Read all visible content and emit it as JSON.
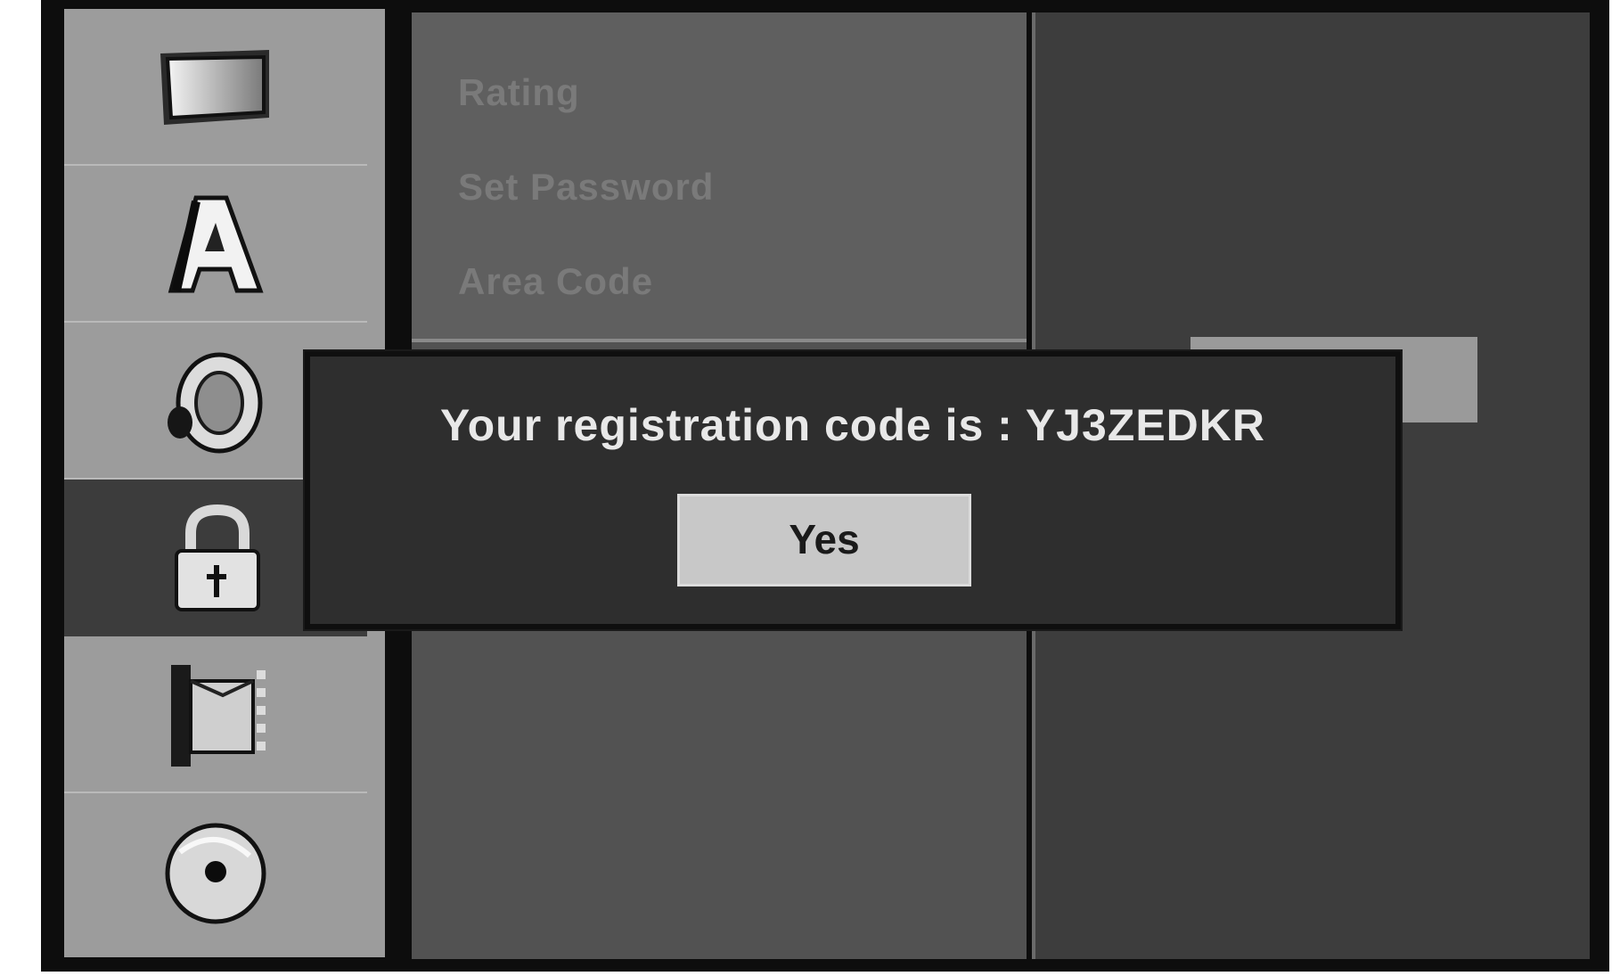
{
  "sidebar": {
    "items": [
      {
        "icon": "tv-screen-icon",
        "active": false
      },
      {
        "icon": "language-a-icon",
        "active": false
      },
      {
        "icon": "speaker-icon",
        "active": false
      },
      {
        "icon": "lock-icon",
        "active": true
      },
      {
        "icon": "film-strip-icon",
        "active": false
      },
      {
        "icon": "disc-icon",
        "active": false
      }
    ]
  },
  "submenu": {
    "items": [
      {
        "label": "Rating"
      },
      {
        "label": "Set Password"
      },
      {
        "label": "Area Code"
      }
    ]
  },
  "dialog": {
    "message": "Your registration code is : YJ3ZEDKR",
    "yes_label": "Yes"
  }
}
